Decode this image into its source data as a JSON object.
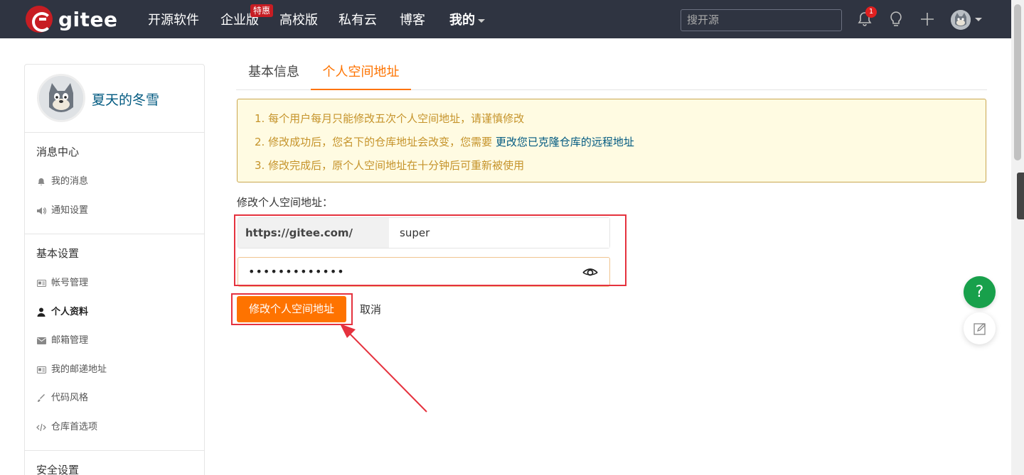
{
  "brand": {
    "name": "gitee"
  },
  "nav": {
    "items": [
      "开源软件",
      "企业版",
      "高校版",
      "私有云",
      "博客",
      "我的"
    ],
    "special_badge": "特惠"
  },
  "search": {
    "placeholder": "搜开源"
  },
  "notifications": {
    "count": "1"
  },
  "profile": {
    "name": "夏天的冬雪"
  },
  "sidebar": {
    "groups": [
      {
        "title": "消息中心",
        "items": [
          {
            "label": "我的消息",
            "icon": "bell-icon"
          },
          {
            "label": "通知设置",
            "icon": "speaker-icon"
          }
        ]
      },
      {
        "title": "基本设置",
        "items": [
          {
            "label": "帐号管理",
            "icon": "id-card-icon"
          },
          {
            "label": "个人资料",
            "icon": "user-icon",
            "active": true
          },
          {
            "label": "邮箱管理",
            "icon": "envelope-icon"
          },
          {
            "label": "我的邮递地址",
            "icon": "address-card-icon"
          },
          {
            "label": "代码风格",
            "icon": "brush-icon"
          },
          {
            "label": "仓库首选项",
            "icon": "code-icon"
          }
        ]
      },
      {
        "title": "安全设置",
        "items": []
      }
    ]
  },
  "tabs": [
    {
      "label": "基本信息",
      "active": false
    },
    {
      "label": "个人空间地址",
      "active": true
    }
  ],
  "notice": {
    "line1": "1. 每个用户每月只能修改五次个人空间地址，请谨慎修改",
    "line2_prefix": "2. 修改成功后，您名下的仓库地址会改变，您需要 ",
    "line2_link": "更改您已克隆仓库的远程地址",
    "line3": "3. 修改完成后，原个人空间地址在十分钟后可重新被使用"
  },
  "form": {
    "label": "修改个人空间地址：",
    "url_prefix": "https://gitee.com/",
    "url_value": "super",
    "password_value": "•••••••••••••",
    "submit_label": "修改个人空间地址",
    "cancel_label": "取消"
  },
  "floating": {
    "help_label": "?"
  },
  "colors": {
    "accent": "#fe7300",
    "nav_bg": "#2f3441",
    "brand_red": "#c71d23",
    "link": "#005980",
    "annotation_red": "#e5323e"
  }
}
